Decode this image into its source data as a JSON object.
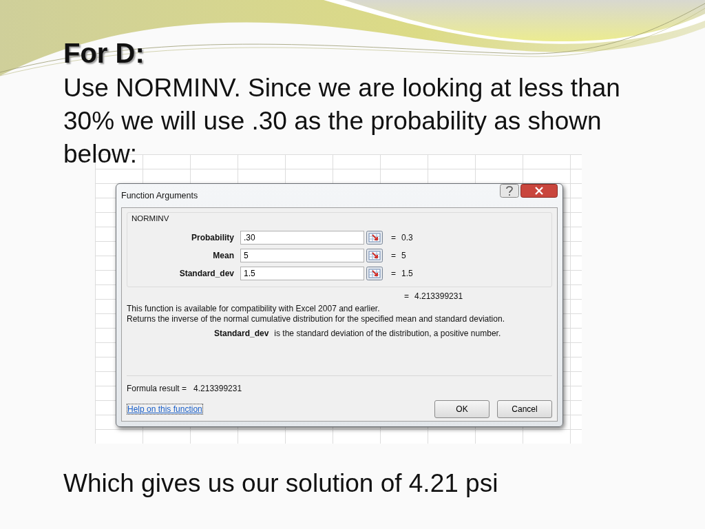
{
  "slide": {
    "title": "For D:",
    "paragraph": "Use NORMINV.  Since we are looking at less than 30% we will use .30 as the probability as shown below:",
    "conclusion": "Which gives us our solution of 4.21 psi"
  },
  "dialog": {
    "title": "Function Arguments",
    "function_name": "NORMINV",
    "arguments": [
      {
        "label": "Probability",
        "value": ".30",
        "sign": "=",
        "result": "0.3"
      },
      {
        "label": "Mean",
        "value": "5",
        "sign": "=",
        "result": "5"
      },
      {
        "label": "Standard_dev",
        "value": "1.5",
        "sign": "=",
        "result": "1.5"
      }
    ],
    "total": {
      "sign": "=",
      "result": "4.213399231"
    },
    "description": [
      "This function is available for compatibility with Excel 2007 and earlier.",
      "Returns the inverse of the normal cumulative distribution for the specified mean and standard deviation."
    ],
    "argument_help": {
      "name": "Standard_dev",
      "text": "is the standard deviation of the distribution, a positive number."
    },
    "formula_result": {
      "label": "Formula result =",
      "value": "4.213399231"
    },
    "help_link": "Help on this function",
    "buttons": [
      "OK",
      "Cancel"
    ]
  }
}
